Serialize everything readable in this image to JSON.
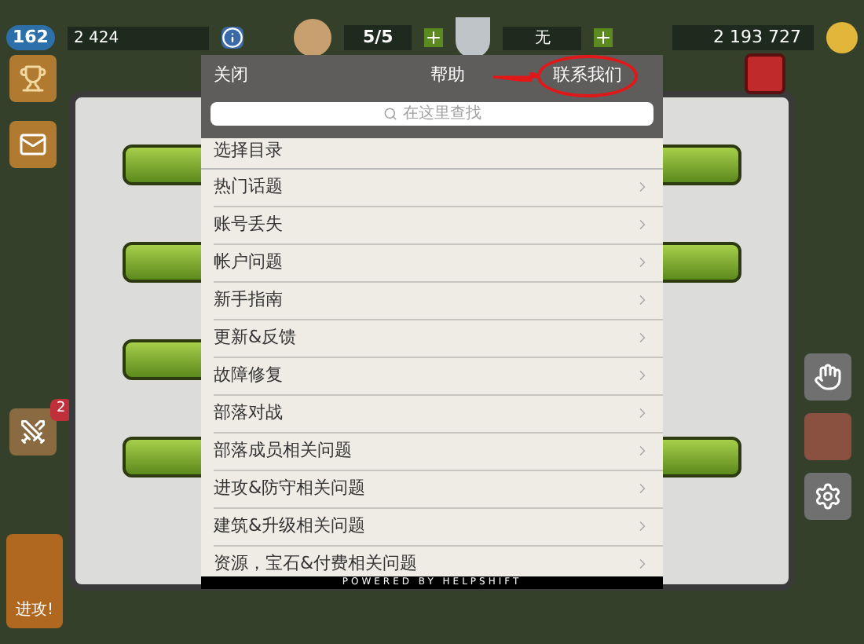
{
  "hud": {
    "level": "162",
    "experience": "2 424",
    "builders": "5/5",
    "shield": "无",
    "gold": "2 193 727"
  },
  "side_badge": "2",
  "attack_button": "进攻!",
  "help": {
    "close": "关闭",
    "title": "帮助",
    "contact": "联系我们",
    "contact_highlighted": true,
    "search_placeholder": "在这里查找",
    "section": "选择目录",
    "items": [
      "热门话题",
      "账号丢失",
      "帐户问题",
      "新手指南",
      "更新&反馈",
      "故障修复",
      "部落对战",
      "部落成员相关问题",
      "进攻&防守相关问题",
      "建筑&升级相关问题",
      "资源，宝石&付费相关问题"
    ],
    "footer": "POWERED BY HELPSHIFT"
  }
}
